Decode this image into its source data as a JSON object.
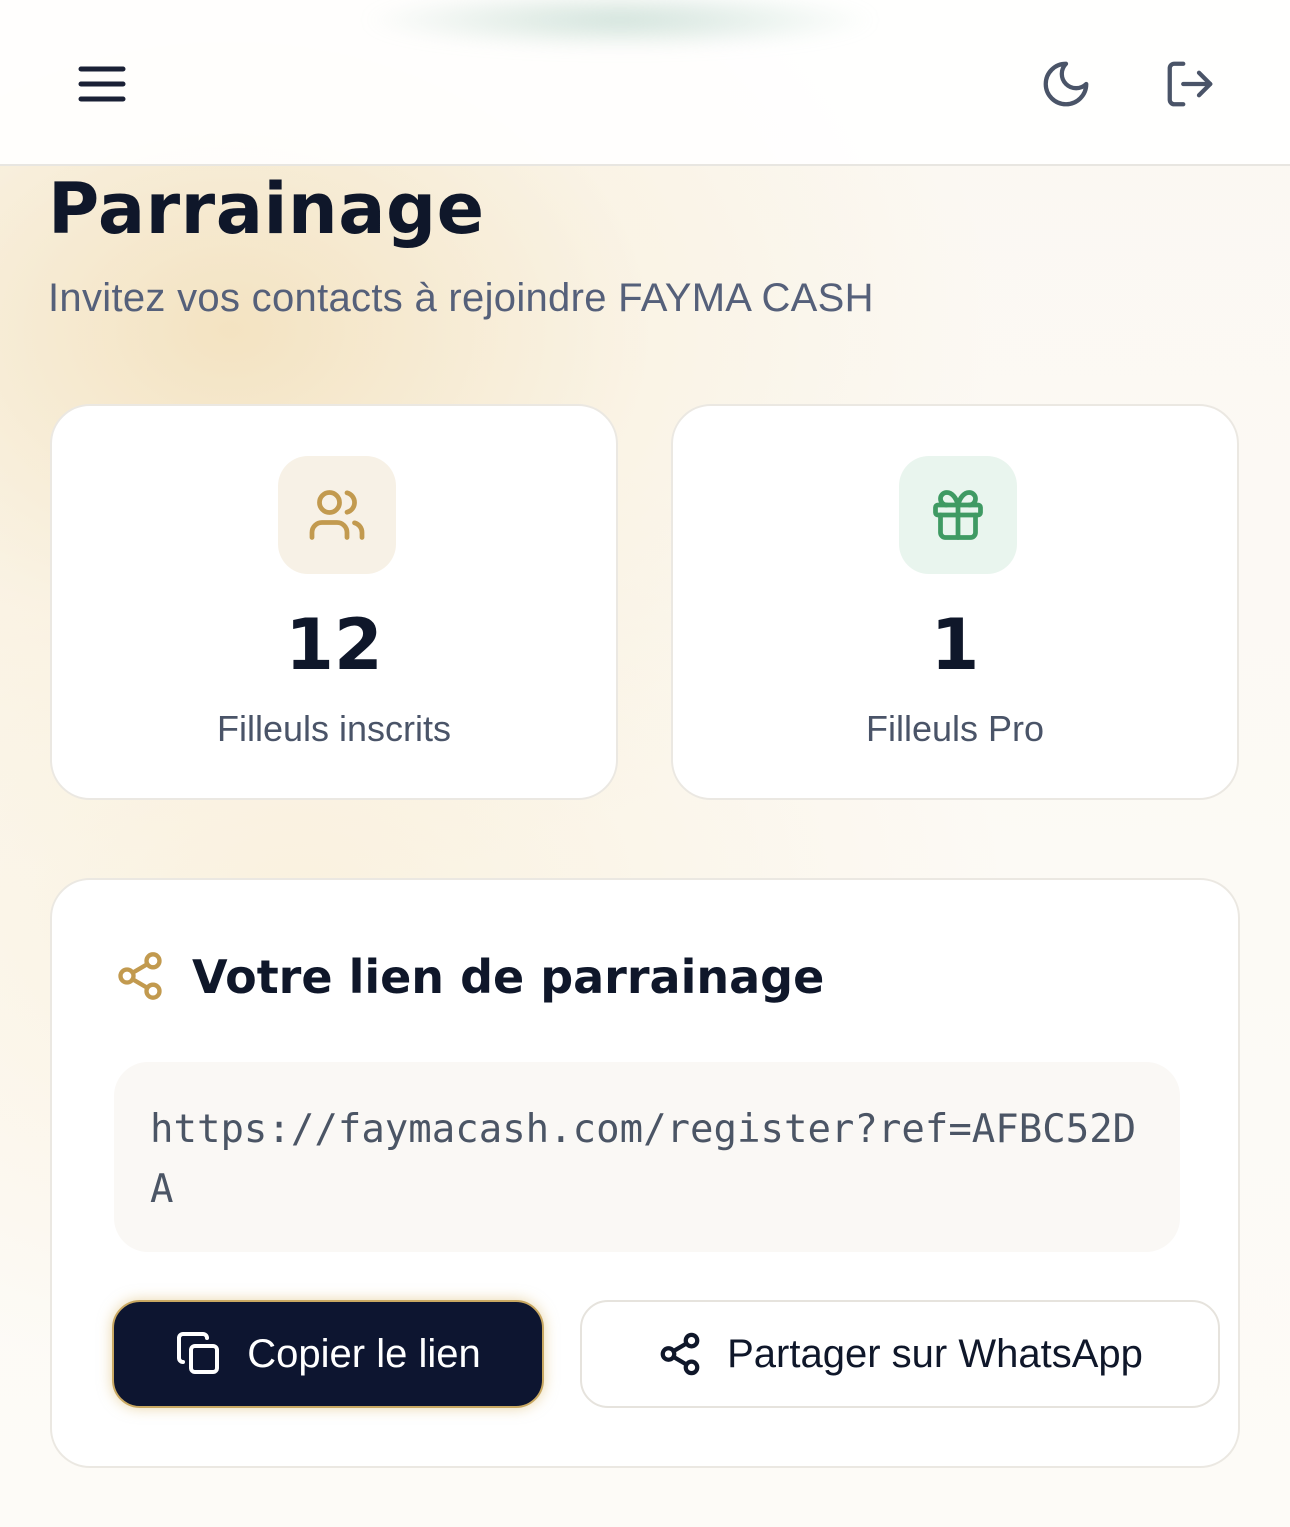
{
  "header": {
    "menu_icon": "hamburger-menu-icon",
    "theme_icon": "moon-icon",
    "logout_icon": "logout-icon"
  },
  "page": {
    "title": "Parrainage",
    "subtitle": "Invitez vos contacts à rejoindre FAYMA CASH"
  },
  "stats": [
    {
      "icon": "users-icon",
      "value": "12",
      "label": "Filleuls inscrits",
      "accent": "#c29a4f"
    },
    {
      "icon": "gift-icon",
      "value": "1",
      "label": "Filleuls Pro",
      "accent": "#3f9a63"
    }
  ],
  "referral": {
    "title": "Votre lien de parrainage",
    "icon": "share-icon",
    "link": "https://faymacash.com/register?ref=AFBC52DA",
    "copy_label": "Copier le lien",
    "share_label": "Partager sur WhatsApp"
  },
  "colors": {
    "brand_dark": "#0d1530",
    "gold": "#c29a4f",
    "green": "#3f9a63"
  }
}
